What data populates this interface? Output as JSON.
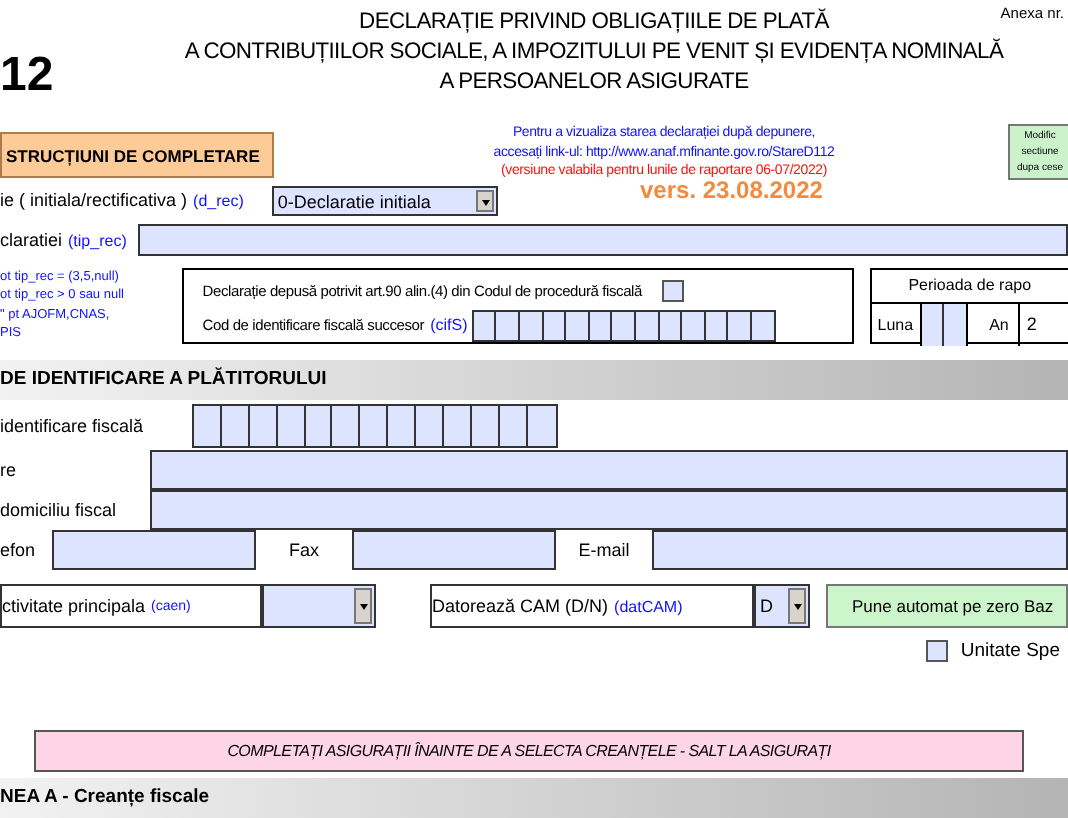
{
  "header": {
    "form_number": "12",
    "annex": "Anexa nr.",
    "title_lines": [
      "DECLARAȚIE PRIVIND OBLIGAȚIILE DE PLATĂ",
      "A CONTRIBUȚIILOR SOCIALE, A IMPOZITULUI PE VENIT ȘI EVIDENȚA NOMINALĂ",
      "A PERSOANELOR ASIGURATE"
    ]
  },
  "instructions_button": "STRUCȚIUNI DE COMPLETARE",
  "notice_lines": [
    {
      "kind": "info",
      "text": "Pentru a vizualiza starea declarației după depunere,"
    },
    {
      "kind": "info",
      "text": "accesați link-ul: http://www.anaf.mfinante.gov.ro/StareD112"
    },
    {
      "kind": "validity",
      "text": "(versiune valabila pentru lunile de raportare 06-07/2022)"
    }
  ],
  "version": "vers. 23.08.2022",
  "modify_box": [
    "Modific",
    "sectiune",
    "dupa cese"
  ],
  "declaration_type": {
    "label": "ie ( initiala/rectificativa )",
    "code": "(d_rec)",
    "value": "0-Declaratie initiala"
  },
  "declaration_kind": {
    "label": "claratiei",
    "code": "(tip_rec)"
  },
  "notes": [
    "ot tip_rec = (3,5,null)",
    "ot tip_rec > 0 sau null",
    "\" pt AJOFM,CNAS,",
    "PIS"
  ],
  "art90": {
    "label": "Declarație depusă potrivit art.90 alin.(4) din Codul de procedură fiscală",
    "checked": false
  },
  "successor": {
    "label": "Cod de identificare fiscală succesor",
    "code": "(cifS)"
  },
  "period": {
    "title": "Perioada de rapo",
    "month_label": "Luna",
    "year_label": "An",
    "year_value": "2"
  },
  "payer": {
    "title": "DE IDENTIFICARE A PLĂTITORULUI",
    "cif_label": "identificare fiscală",
    "name_label": "re",
    "address_label": "domiciliu fiscal",
    "phone_label": "efon",
    "fax_label": "Fax",
    "email_label": "E-mail"
  },
  "activity": {
    "label": "ctivitate principala",
    "code": "(caen)"
  },
  "cam": {
    "label": "Datorează CAM (D/N)",
    "code": "(datCAM)",
    "value": "D"
  },
  "zero_button": "Pune automat pe zero Baz",
  "special_unit": {
    "label": "Unitate Spe",
    "checked": false
  },
  "banner": "COMPLETAȚI ASIGURAȚII ÎNAINTE DE A SELECTA CREANȚELE - SALT LA ASIGURAȚI",
  "section_a": "NEA A - Creanțe fiscale"
}
